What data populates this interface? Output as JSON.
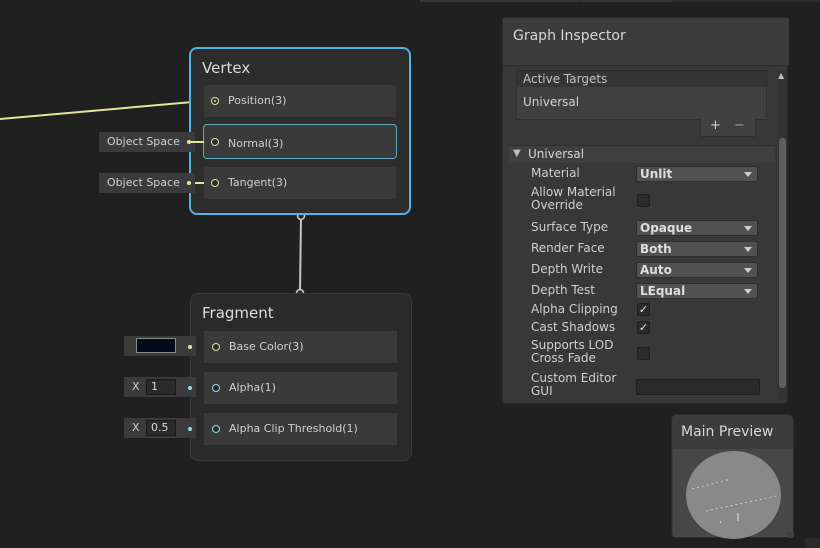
{
  "vertex_node": {
    "title": "Vertex",
    "slots": [
      {
        "label": "Position(3)"
      },
      {
        "label": "Normal(3)",
        "input": "Object Space"
      },
      {
        "label": "Tangent(3)",
        "input": "Object Space"
      }
    ]
  },
  "fragment_node": {
    "title": "Fragment",
    "slots": [
      {
        "label": "Base Color(3)"
      },
      {
        "label": "Alpha(1)",
        "x_label": "X",
        "value": "1"
      },
      {
        "label": "Alpha Clip Threshold(1)",
        "x_label": "X",
        "value": "0.5"
      }
    ]
  },
  "colors": {
    "selection_outline": "#4fb4e8",
    "vector3_wire": "#e4e598",
    "float_port": "#84e4e7",
    "base_color_value": "#050a1a"
  },
  "inspector": {
    "title": "Graph Inspector",
    "active_targets": {
      "title": "Active Targets",
      "items": [
        "Universal"
      ],
      "add_label": "+",
      "remove_label": "−"
    },
    "section": {
      "title": "Universal",
      "foldout_icon": "triangle-down-icon",
      "properties": {
        "material": {
          "label": "Material",
          "value": "Unlit"
        },
        "allow_override": {
          "label": "Allow Material Override",
          "checked": false
        },
        "surface_type": {
          "label": "Surface Type",
          "value": "Opaque"
        },
        "render_face": {
          "label": "Render Face",
          "value": "Both"
        },
        "depth_write": {
          "label": "Depth Write",
          "value": "Auto"
        },
        "depth_test": {
          "label": "Depth Test",
          "value": "LEqual"
        },
        "alpha_clipping": {
          "label": "Alpha Clipping",
          "checked": true,
          "mark": "✓"
        },
        "cast_shadows": {
          "label": "Cast Shadows",
          "checked": true,
          "mark": "✓"
        },
        "supports_lod": {
          "label": "Supports LOD Cross Fade",
          "checked": false
        },
        "custom_editor_gui": {
          "label": "Custom Editor GUI",
          "value": ""
        }
      }
    }
  },
  "preview": {
    "title": "Main Preview"
  }
}
